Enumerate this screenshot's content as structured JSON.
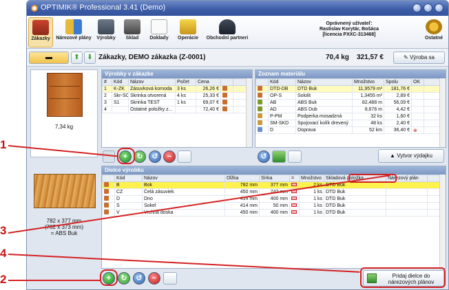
{
  "app": {
    "title": "OPTIMIK® Professional 3.41 (Demo)",
    "toolbar": [
      "Zákazky",
      "Nárezové plány",
      "Výrobky",
      "Sklad",
      "Doklady",
      "Operácie",
      "Obchodní partneri",
      "Ostatné"
    ],
    "user": [
      "Oprávnený užívateľ:",
      "Rastislav Korytár, Bošáca",
      "[licencia PXXC-313468]"
    ]
  },
  "order": {
    "title": "Zákazky, DEMO zákazka  (Z-0001)",
    "weight": "70,4 kg",
    "price": "321,57 €",
    "vyroba_label": "Výroba sa"
  },
  "products": {
    "title": "Výrobky v zákazke",
    "headers": [
      "#",
      "Kód",
      "Názov",
      "Počet",
      "Cena"
    ],
    "rows": [
      [
        "1",
        "K-ZK",
        "Zásuvková komoda",
        "3 ks",
        "26,26 €"
      ],
      [
        "2",
        "Skr-SO",
        "Skrinka otvorená",
        "4 ks",
        "25,33 €"
      ],
      [
        "3",
        "S1",
        "Skrinka TEST",
        "1 ks",
        "69,07 €"
      ],
      [
        "4",
        "",
        "Ostatné položky z...",
        "",
        "72,40 €"
      ]
    ],
    "thumb_weight": "7,34 kg"
  },
  "materials": {
    "title": "Zoznam materiálu",
    "headers": [
      "Kód",
      "Názov",
      "Množstvo",
      "Spolu",
      "OK"
    ],
    "rows": [
      [
        "DTD-DB",
        "DTD Buk",
        "11,9579 m²",
        "181,76 €"
      ],
      [
        "OP-S",
        "Sololit",
        "1,3455 m²",
        "2,89 €"
      ],
      [
        "AB",
        "ABS Buk",
        "82,488 m",
        "56,09 €"
      ],
      [
        "AD",
        "ABS Dub",
        "8,676 m",
        "4,42 €"
      ],
      [
        "P-PM",
        "Podperka mosadzná",
        "32 ks",
        "1,60 €"
      ],
      [
        "SM-SKD",
        "Spojovací kolík drevený",
        "48 ks",
        "2,40 €"
      ],
      [
        "D",
        "Doprava",
        "52 km",
        "36,40 €"
      ]
    ],
    "create_label": "Vytvor výdajku"
  },
  "parts": {
    "title": "Dielce výrobku",
    "headers": [
      "Kód",
      "Názov",
      "Dĺžka",
      "Šírka",
      "=",
      "Množstvo",
      "Skladová položka",
      "Nárezový plán"
    ],
    "rows": [
      [
        "B",
        "Bok",
        "782 mm",
        "377 mm",
        "2 ks",
        "DTD Buk"
      ],
      [
        "CZ",
        "Čelá zásuviek",
        "450 mm",
        "742 mm",
        "1 ks",
        "DTD Buk"
      ],
      [
        "D",
        "Dno",
        "414 mm",
        "400 mm",
        "1 ks",
        "DTD Buk"
      ],
      [
        "S",
        "Sokel",
        "414 mm",
        "50 mm",
        "1 ks",
        "DTD Buk"
      ],
      [
        "V",
        "Vrchná doska",
        "450 mm",
        "400 mm",
        "1 ks",
        "DTD Buk"
      ]
    ],
    "thumb_info": [
      "782 x 377 mm",
      "(782 x 373 mm)",
      "= ABS Buk"
    ],
    "add_to_plan_label": [
      "Pridaj dielce do",
      "nárezových plánov"
    ]
  },
  "callouts": [
    "1",
    "2",
    "3",
    "4"
  ],
  "colors": {
    "accent": "#d42020",
    "selected_row": "#fff24d"
  }
}
